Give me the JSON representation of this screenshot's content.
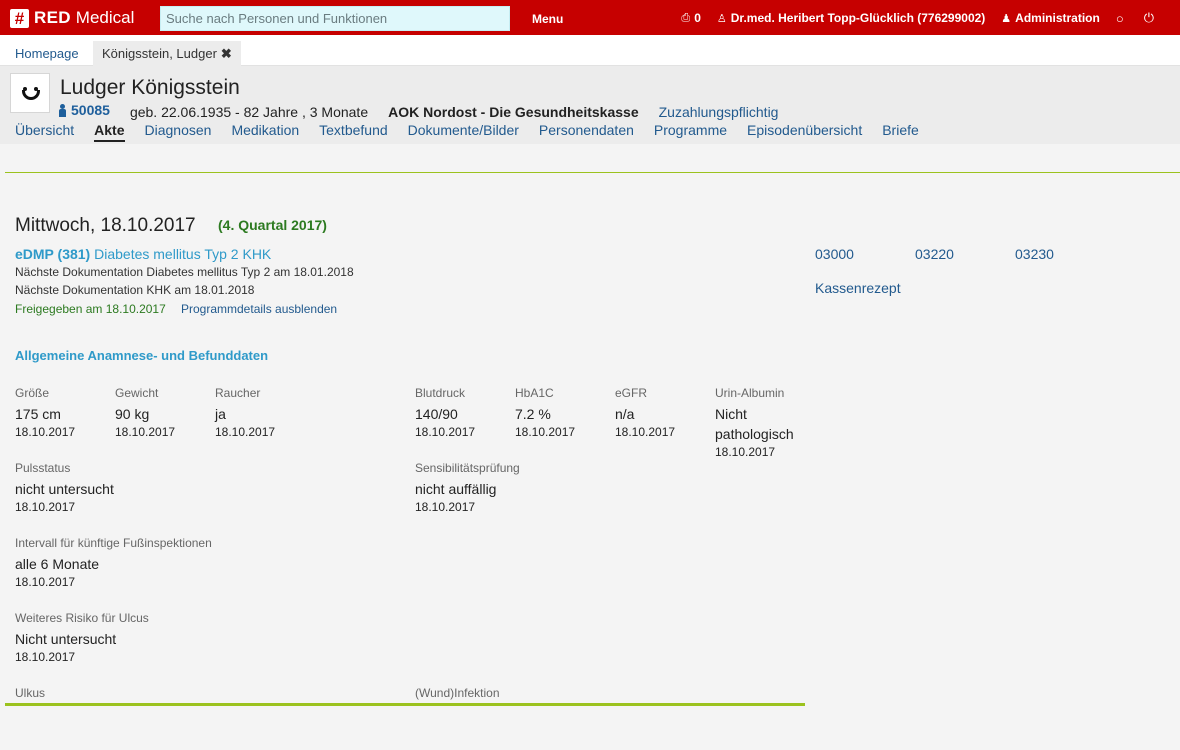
{
  "app": {
    "logo_icon": "#",
    "logo_red": "RED",
    "logo_medical": "Medical"
  },
  "topbar": {
    "search_placeholder": "Suche nach Personen und Funktionen",
    "menu_label": "Menu",
    "print_count": "0",
    "user": "Dr.med. Heribert Topp-Glücklich (776299002)",
    "admin_label": "Administration",
    "icons": [
      "printer-icon",
      "user-md-icon",
      "users-icon",
      "chat-icon",
      "power-icon"
    ]
  },
  "tabs": {
    "home": "Homepage",
    "patient": "Königsstein, Ludger",
    "close_glyph": "✖"
  },
  "patient": {
    "name": "Ludger Königsstein",
    "id": "50085",
    "birth": "geb. 22.06.1935 - 82 Jahre , 3 Monate",
    "insurer": "AOK Nordost - Die Gesundheitskasse",
    "copay": "Zuzahlungspflichtig"
  },
  "nav": [
    "Übersicht",
    "Akte",
    "Diagnosen",
    "Medikation",
    "Textbefund",
    "Dokumente/Bilder",
    "Personendaten",
    "Programme",
    "Episodenübersicht",
    "Briefe"
  ],
  "nav_active": "Akte",
  "entry": {
    "date": "Mittwoch, 18.10.2017",
    "quarter": "(4. Quartal 2017)",
    "program_bold": "eDMP (381)",
    "program_rest": "Diabetes mellitus Typ 2 KHK",
    "next_doc_1": "Nächste Dokumentation Diabetes mellitus Typ 2 am 18.01.2018",
    "next_doc_2": "Nächste Dokumentation KHK am 18.01.2018",
    "released": "Freigegeben am 18.10.2017",
    "hide_details": "Programmdetails ausblenden",
    "codes": [
      "03000",
      "03220",
      "03230"
    ],
    "prescription": "Kassenrezept"
  },
  "section": {
    "title": "Allgemeine Anamnese- und Befunddaten",
    "fields": {
      "groesse": {
        "label": "Größe",
        "value": "175 cm",
        "date": "18.10.2017"
      },
      "gewicht": {
        "label": "Gewicht",
        "value": "90 kg",
        "date": "18.10.2017"
      },
      "raucher": {
        "label": "Raucher",
        "value": "ja",
        "date": "18.10.2017"
      },
      "blutdruck": {
        "label": "Blutdruck",
        "value": "140/90",
        "date": "18.10.2017"
      },
      "hba1c": {
        "label": "HbA1C",
        "value": "7.2 %",
        "date": "18.10.2017"
      },
      "egfr": {
        "label": "eGFR",
        "value": "n/a",
        "date": "18.10.2017"
      },
      "urin": {
        "label": "Urin-Albumin",
        "value1": "Nicht",
        "value2": "pathologisch",
        "date": "18.10.2017"
      },
      "puls": {
        "label": "Pulsstatus",
        "value": "nicht untersucht",
        "date": "18.10.2017"
      },
      "sensi": {
        "label": "Sensibilitätsprüfung",
        "value": "nicht auffällig",
        "date": "18.10.2017"
      },
      "intervall": {
        "label": "Intervall für künftige Fußinspektionen",
        "value": "alle 6 Monate",
        "date": "18.10.2017"
      },
      "ulcus_risk": {
        "label": "Weiteres Risiko für Ulcus",
        "value": "Nicht untersucht",
        "date": "18.10.2017"
      },
      "ulkus": {
        "label": "Ulkus"
      },
      "wund": {
        "label": "(Wund)Infektion"
      }
    }
  },
  "colors": {
    "topbar": "#c60000",
    "link": "#225a8e",
    "accent_blue": "#2f9ac9",
    "green": "#2c7a20",
    "line_green": "#9bc21e"
  }
}
